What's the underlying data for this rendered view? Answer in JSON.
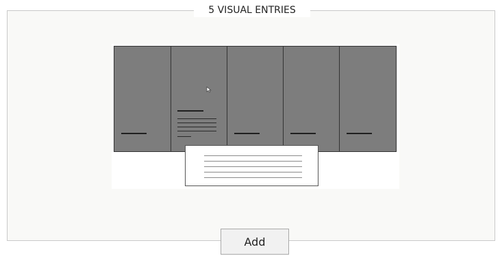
{
  "group": {
    "title": "5 VISUAL ENTRIES"
  },
  "buttons": {
    "add_label": "Add"
  },
  "icons": {
    "cursor": "arrow-cursor-icon"
  }
}
